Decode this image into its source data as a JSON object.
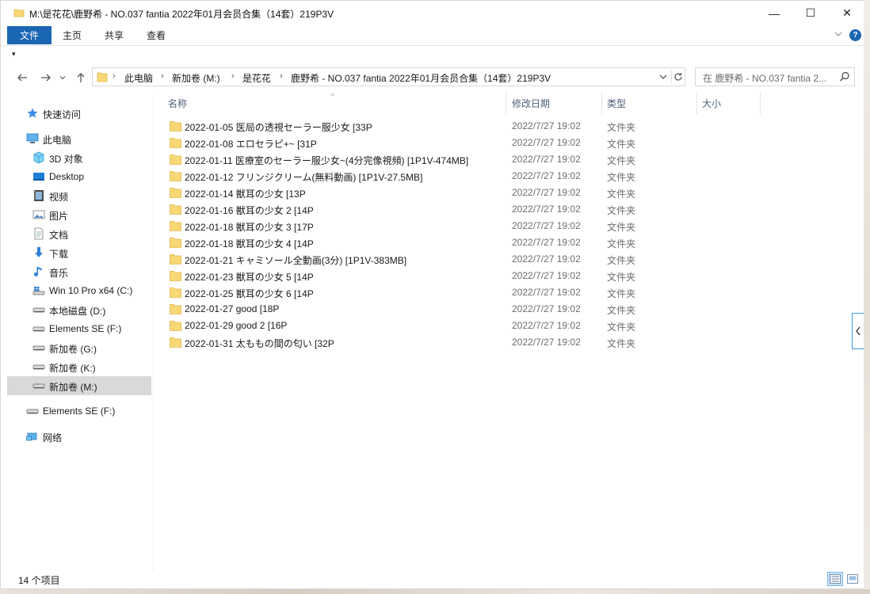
{
  "window": {
    "title": "M:\\是花花\\鹿野希 - NO.037 fantia 2022年01月会员合集（14套）219P3V",
    "minimize_glyph": "—",
    "maximize_glyph": "☐",
    "close_glyph": "✕"
  },
  "ribbon": {
    "tabs": [
      "文件",
      "主页",
      "共享",
      "查看"
    ],
    "help_label": "?"
  },
  "quick_access_toolbar": {
    "dropdown_glyph": "▾"
  },
  "address_bar": {
    "crumbs": [
      "此电脑",
      "新加卷 (M:)",
      "是花花",
      "鹿野希 - NO.037 fantia 2022年01月会员合集（14套）219P3V"
    ],
    "separator": "›"
  },
  "search": {
    "placeholder": "在 鹿野希 - NO.037 fantia 2..."
  },
  "sidebar": {
    "items": [
      {
        "label": "快速访问",
        "icon": "star-icon"
      },
      {
        "label": "此电脑",
        "icon": "computer-icon"
      },
      {
        "label": "3D 对象",
        "icon": "cube-icon"
      },
      {
        "label": "Desktop",
        "icon": "desktop-icon"
      },
      {
        "label": "视频",
        "icon": "video-icon"
      },
      {
        "label": "图片",
        "icon": "picture-icon"
      },
      {
        "label": "文档",
        "icon": "document-icon"
      },
      {
        "label": "下载",
        "icon": "download-icon"
      },
      {
        "label": "音乐",
        "icon": "music-icon"
      },
      {
        "label": "Win 10 Pro x64 (C:)",
        "icon": "windows-drive-icon"
      },
      {
        "label": "本地磁盘 (D:)",
        "icon": "drive-icon"
      },
      {
        "label": "Elements SE (F:)",
        "icon": "drive-icon"
      },
      {
        "label": "新加卷 (G:)",
        "icon": "drive-icon"
      },
      {
        "label": "新加卷 (K:)",
        "icon": "drive-icon"
      },
      {
        "label": "新加卷 (M:)",
        "icon": "drive-icon",
        "selected": true
      },
      {
        "label": "Elements SE (F:)",
        "icon": "drive-icon"
      },
      {
        "label": "网络",
        "icon": "network-icon"
      }
    ]
  },
  "file_list": {
    "columns": [
      "名称",
      "修改日期",
      "类型",
      "大小"
    ],
    "sort_glyph": "^",
    "rows": [
      {
        "name": "2022-01-05 医局の透視セーラー服少女 [33P",
        "date": "2022/7/27 19:02",
        "type": "文件夹"
      },
      {
        "name": "2022-01-08 エロセラピ+~ [31P",
        "date": "2022/7/27 19:02",
        "type": "文件夹"
      },
      {
        "name": "2022-01-11 医療室のセーラー服少女~(4分完像視頻) [1P1V-474MB]",
        "date": "2022/7/27 19:02",
        "type": "文件夹"
      },
      {
        "name": "2022-01-12 フリンジクリーム(無料動画) [1P1V-27.5MB]",
        "date": "2022/7/27 19:02",
        "type": "文件夹"
      },
      {
        "name": "2022-01-14 獣耳の少女 [13P",
        "date": "2022/7/27 19:02",
        "type": "文件夹"
      },
      {
        "name": "2022-01-16 獣耳の少女 2 [14P",
        "date": "2022/7/27 19:02",
        "type": "文件夹"
      },
      {
        "name": "2022-01-18 獣耳の少女 3 [17P",
        "date": "2022/7/27 19:02",
        "type": "文件夹"
      },
      {
        "name": "2022-01-18 獣耳の少女 4 [14P",
        "date": "2022/7/27 19:02",
        "type": "文件夹"
      },
      {
        "name": "2022-01-21 キャミソール全動画(3分) [1P1V-383MB]",
        "date": "2022/7/27 19:02",
        "type": "文件夹"
      },
      {
        "name": "2022-01-23 獣耳の少女 5 [14P",
        "date": "2022/7/27 19:02",
        "type": "文件夹"
      },
      {
        "name": "2022-01-25 獣耳の少女 6 [14P",
        "date": "2022/7/27 19:02",
        "type": "文件夹"
      },
      {
        "name": "2022-01-27 good [18P",
        "date": "2022/7/27 19:02",
        "type": "文件夹"
      },
      {
        "name": "2022-01-29 good 2 [16P",
        "date": "2022/7/27 19:02",
        "type": "文件夹"
      },
      {
        "name": "2022-01-31 太ももの間の匂い [32P",
        "date": "2022/7/27 19:02",
        "type": "文件夹"
      }
    ]
  },
  "status_bar": {
    "item_count": "14 个项目"
  },
  "colors": {
    "accent": "#1a66b3",
    "folder": "#f8d775",
    "selection": "#d9d9d9",
    "header_text": "#4c607a"
  }
}
